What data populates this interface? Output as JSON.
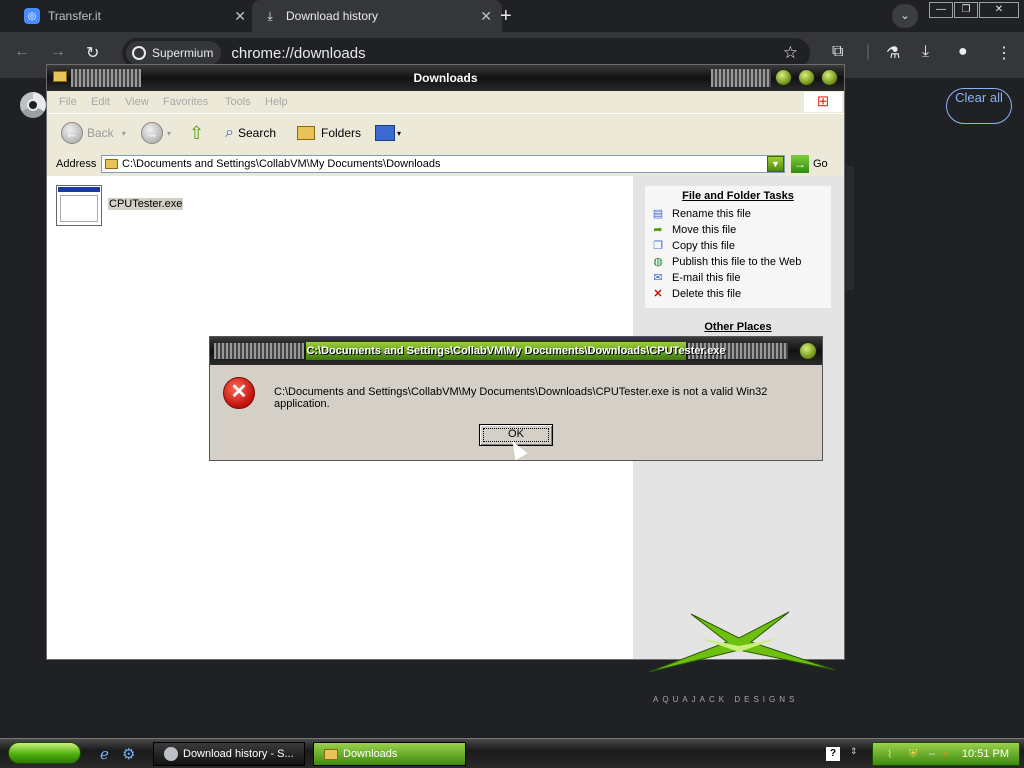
{
  "browser": {
    "tabs": [
      {
        "title": "Transfer.it",
        "active": false
      },
      {
        "title": "Download history",
        "active": true
      }
    ],
    "omnibox": {
      "site_chip": "Supermium",
      "url": "chrome://downloads"
    },
    "downloads_page": {
      "clear_all_label": "Clear all"
    }
  },
  "explorer": {
    "title": "Downloads",
    "menu": [
      "File",
      "Edit",
      "View",
      "Favorites",
      "Tools",
      "Help"
    ],
    "toolbar": {
      "back": "Back",
      "search": "Search",
      "folders": "Folders"
    },
    "address": {
      "label": "Address",
      "value": "C:\\Documents and Settings\\CollabVM\\My Documents\\Downloads",
      "go": "Go"
    },
    "files": [
      {
        "name": "CPUTester.exe"
      }
    ],
    "tasks": {
      "title": "File and Folder Tasks",
      "items": [
        "Rename this file",
        "Move this file",
        "Copy this file",
        "Publish this file to the Web",
        "E-mail this file",
        "Delete this file"
      ],
      "other_places_title": "Other Places"
    },
    "branding": "AQUAJACK DESIGNS"
  },
  "dialog": {
    "title": "C:\\Documents and Settings\\CollabVM\\My Documents\\Downloads\\CPUTester.exe",
    "message": "C:\\Documents and Settings\\CollabVM\\My Documents\\Downloads\\CPUTester.exe is not a valid Win32 application.",
    "ok_label": "OK"
  },
  "taskbar": {
    "buttons": [
      {
        "label": "Download history - S..."
      },
      {
        "label": "Downloads"
      }
    ],
    "clock": "10:51 PM"
  },
  "colors": {
    "xp_green": "#4fb010",
    "error_red": "#c0100a",
    "chrome_bg": "#202124"
  }
}
